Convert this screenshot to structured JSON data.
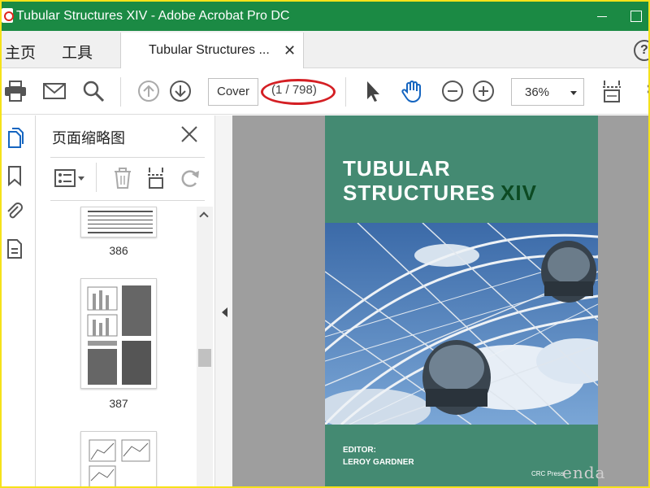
{
  "window": {
    "title": "Tubular Structures XIV - Adobe Acrobat Pro DC"
  },
  "menubar": {
    "home": "主页",
    "tools": "工具",
    "tab_label": "Tubular Structures ...",
    "tab_close": "✕",
    "help": "?"
  },
  "toolbar": {
    "page_label": "Cover",
    "page_count": "(1 / 798)",
    "zoom": "36%"
  },
  "thumbnails": {
    "title": "页面缩略图",
    "pages": [
      "386",
      "387"
    ]
  },
  "cover": {
    "title_line1": "TUBULAR",
    "title_line2": "STRUCTURES",
    "title_roman": "XIV",
    "editor_label": "EDITOR:",
    "editor_name": "LEROY GARDNER",
    "publisher": "CRC Press"
  },
  "watermark": "enda",
  "colors": {
    "titlebar": "#1b8a44",
    "cover_green": "#448a72",
    "highlight_oval": "#d41f24"
  },
  "icons": [
    "print-icon",
    "email-icon",
    "search-icon",
    "arrow-up-icon",
    "arrow-down-icon",
    "cursor-icon",
    "hand-icon",
    "zoom-out-icon",
    "zoom-in-icon",
    "fit-page-icon",
    "more-icon"
  ]
}
